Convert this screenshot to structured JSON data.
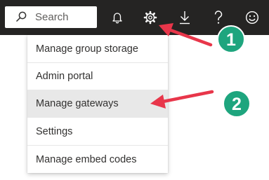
{
  "header": {
    "search": {
      "placeholder": "Search"
    },
    "icons": [
      "bell-icon",
      "gear-icon",
      "download-icon",
      "help-icon",
      "smiley-icon"
    ]
  },
  "menu": {
    "items": [
      {
        "label": "Manage group storage"
      },
      {
        "label": "Admin portal"
      },
      {
        "label": "Manage gateways",
        "highlighted": true
      },
      {
        "label": "Settings"
      },
      {
        "label": "Manage embed codes"
      }
    ]
  },
  "annotations": {
    "step1": "1",
    "step2": "2",
    "arrow_color": "#e8364a",
    "badge_color": "#1ea57e"
  },
  "colors": {
    "topbar": "#252423",
    "menu_highlight": "#e8e8e8"
  }
}
